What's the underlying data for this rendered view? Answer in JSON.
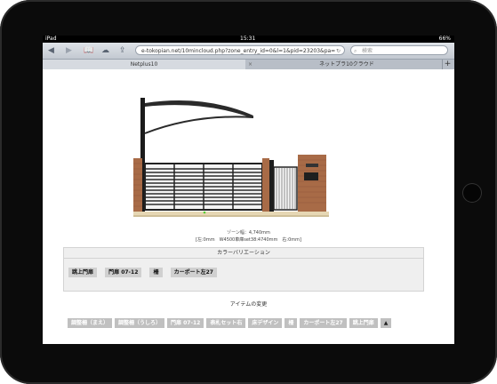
{
  "status": {
    "device": "iPad",
    "time": "15:31",
    "battery": "66%"
  },
  "toolbar": {
    "back_icon": "back-arrow",
    "forward_icon": "forward-arrow",
    "url": "e-tokopian.net/10mincloud.php?zone_entry_id=0&l=1&pid=23203&pa=",
    "search_placeholder": "検索"
  },
  "tabs": {
    "tab1": "Netplus10",
    "tab2": "ネットプラ10クラウド"
  },
  "spec": {
    "zone": "ゾーン幅：4,740mm",
    "detail": "[左:0mm　W4500車庫set38:4740mm　右:0mm]"
  },
  "color_panel": {
    "title": "カラーバリエーション",
    "chips": [
      "跳上門扉",
      "門扉 07-12",
      "柵",
      "カーポート左27"
    ]
  },
  "items_section": {
    "title": "アイテムの変更",
    "items": [
      "調整柵（まえ）",
      "調整柵（うしろ）",
      "門扉 07-12",
      "表札セット右",
      "床デザイン",
      "柵",
      "カーポート左27",
      "跳上門扉"
    ],
    "up_button": "▲"
  }
}
